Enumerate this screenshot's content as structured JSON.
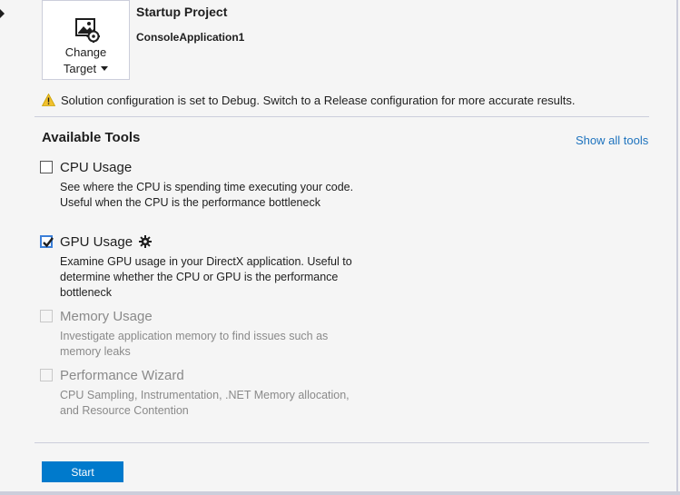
{
  "target": {
    "label_line1": "Change",
    "label_line2": "Target"
  },
  "startup": {
    "title": "Startup Project",
    "project": "ConsoleApplication1"
  },
  "warning": {
    "text": "Solution configuration is set to Debug. Switch to a Release configuration for more accurate results."
  },
  "tools_section": {
    "title": "Available Tools",
    "show_all_label": "Show all tools"
  },
  "tools": [
    {
      "name": "CPU Usage",
      "checked": false,
      "enabled": true,
      "description": "See where the CPU is spending time executing your code. Useful when the CPU is the performance bottleneck"
    },
    {
      "name": "GPU Usage",
      "checked": true,
      "enabled": true,
      "has_settings": true,
      "description": "Examine GPU usage in your DirectX application. Useful to determine whether the CPU or GPU is the performance bottleneck"
    },
    {
      "name": "Memory Usage",
      "checked": false,
      "enabled": false,
      "description": "Investigate application memory to find issues such as memory leaks"
    },
    {
      "name": "Performance Wizard",
      "checked": false,
      "enabled": false,
      "description": "CPU Sampling, Instrumentation, .NET Memory allocation, and Resource Contention"
    }
  ],
  "actions": {
    "start_label": "Start"
  },
  "colors": {
    "accent": "#007acc",
    "link": "#1e73be",
    "checkbox_checked_border": "#3c7fd8",
    "disabled_text": "#8a8a8a",
    "warning": "#f2c12e"
  },
  "icons": {
    "target": "image-settings-icon",
    "warning": "warning-icon",
    "settings": "gear-icon"
  }
}
